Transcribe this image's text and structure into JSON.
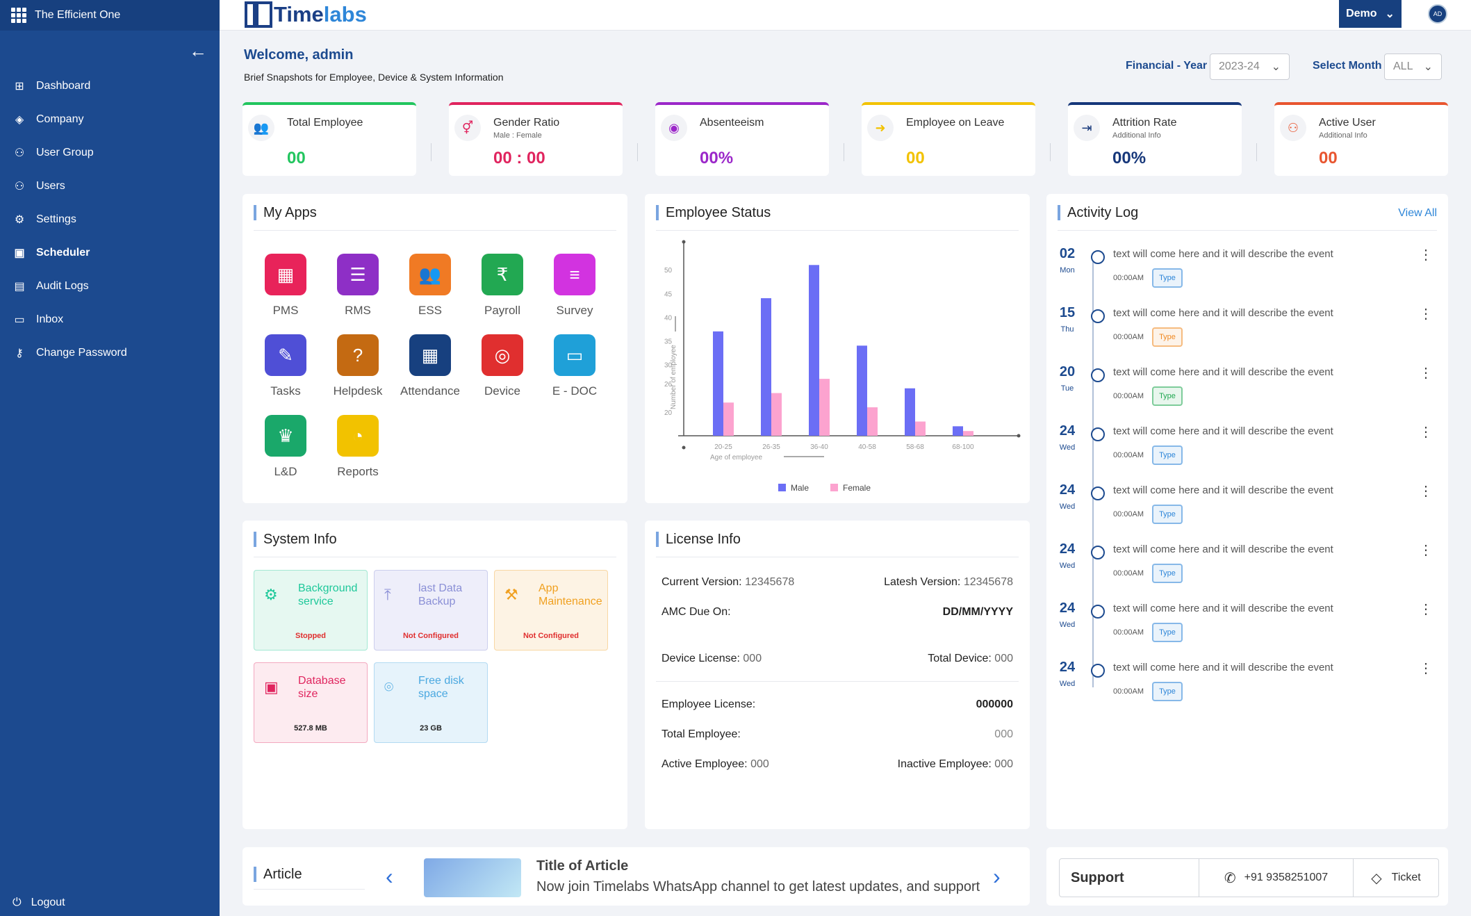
{
  "app": {
    "org_name": "The Efficient One",
    "logo_prefix": "Time",
    "logo_suffix": "labs",
    "user_menu": "Demo",
    "avatar_initials": "AD"
  },
  "sidebar": {
    "items": [
      {
        "label": "Dashboard",
        "icon": "dashboard-icon"
      },
      {
        "label": "Company",
        "icon": "layers-icon"
      },
      {
        "label": "User Group",
        "icon": "user-group-icon"
      },
      {
        "label": "Users",
        "icon": "users-icon"
      },
      {
        "label": "Settings",
        "icon": "gear-icon"
      },
      {
        "label": "Scheduler",
        "icon": "scheduler-icon"
      },
      {
        "label": "Audit Logs",
        "icon": "document-icon"
      },
      {
        "label": "Inbox",
        "icon": "inbox-icon"
      },
      {
        "label": "Change Password",
        "icon": "key-icon"
      }
    ],
    "logout": "Logout"
  },
  "header": {
    "welcome": "Welcome, admin",
    "brief": "Brief Snapshots for Employee, Device & System Information",
    "fy_label": "Financial - Year",
    "fy_value": "2023-24",
    "month_label": "Select Month",
    "month_value": "ALL"
  },
  "stats": [
    {
      "title": "Total Employee",
      "sub": "",
      "value": "00",
      "color": "#22c55e"
    },
    {
      "title": "Gender Ratio",
      "sub": "Male : Female",
      "value": "00 : 00",
      "color": "#e0245e"
    },
    {
      "title": "Absenteeism",
      "sub": "",
      "value": "00%",
      "color": "#9b27c9"
    },
    {
      "title": "Employee on Leave",
      "sub": "",
      "value": "00",
      "color": "#f2c200"
    },
    {
      "title": "Attrition Rate",
      "sub": "Additional Info",
      "value": "00%",
      "color": "#16377a"
    },
    {
      "title": "Active User",
      "sub": "Additional Info",
      "value": "00",
      "color": "#e8552f"
    }
  ],
  "apps": {
    "title": "My Apps",
    "items": [
      {
        "label": "PMS",
        "color": "#e8235a",
        "icon": "bar-chart-icon",
        "glyph": "▦"
      },
      {
        "label": "RMS",
        "color": "#8e2fc6",
        "icon": "list-icon",
        "glyph": "☰"
      },
      {
        "label": "ESS",
        "color": "#f07a24",
        "icon": "people-icon",
        "glyph": "👥"
      },
      {
        "label": "Payroll",
        "color": "#22a852",
        "icon": "money-icon",
        "glyph": "₹"
      },
      {
        "label": "Survey",
        "color": "#d233e0",
        "icon": "survey-icon",
        "glyph": "≡"
      },
      {
        "label": "Tasks",
        "color": "#4f4fd6",
        "icon": "tasks-icon",
        "glyph": "✎"
      },
      {
        "label": "Helpdesk",
        "color": "#c46a12",
        "icon": "help-icon",
        "glyph": "?"
      },
      {
        "label": "Attendance",
        "color": "#17407f",
        "icon": "calendar-icon",
        "glyph": "▦"
      },
      {
        "label": "Device",
        "color": "#e02f2f",
        "icon": "fingerprint-icon",
        "glyph": "◎"
      },
      {
        "label": "E - DOC",
        "color": "#1fa0d8",
        "icon": "folder-icon",
        "glyph": "▭"
      },
      {
        "label": "L&D",
        "color": "#1aa86a",
        "icon": "learning-icon",
        "glyph": "♛"
      },
      {
        "label": "Reports",
        "color": "#f2c200",
        "icon": "pie-icon",
        "glyph": "◔"
      }
    ]
  },
  "employee_status": {
    "title": "Employee Status"
  },
  "chart_data": {
    "type": "bar",
    "categories": [
      "20-25",
      "26-35",
      "36-40",
      "40-58",
      "58-68",
      "68-100"
    ],
    "series": [
      {
        "name": "Male",
        "values": [
          37,
          44,
          51,
          34,
          25,
          17
        ]
      },
      {
        "name": "Female",
        "values": [
          22,
          24,
          27,
          21,
          18,
          16
        ]
      }
    ],
    "xlabel": "Age of employee",
    "ylabel": "Number of employee",
    "yticks": [
      "20",
      "26",
      "30",
      "35",
      "40",
      "45",
      "50"
    ],
    "ylim": [
      15,
      55
    ],
    "colors": {
      "Male": "#6b6ef5",
      "Female": "#fca3cf"
    },
    "legend": "bottom"
  },
  "activity": {
    "title": "Activity Log",
    "view_all": "View All",
    "items": [
      {
        "day": "02",
        "dow": "Mon",
        "text": "text will come here and it will describe the event",
        "time": "00:00AM",
        "type": "Type",
        "type_color": "#2e86d8"
      },
      {
        "day": "15",
        "dow": "Thu",
        "text": "text will come here and it will describe the event",
        "time": "00:00AM",
        "type": "Type",
        "type_color": "#f08a24"
      },
      {
        "day": "20",
        "dow": "Tue",
        "text": "text will come here and it will describe the event",
        "time": "00:00AM",
        "type": "Type",
        "type_color": "#22a852"
      },
      {
        "day": "24",
        "dow": "Wed",
        "text": "text will come here and it will describe the event",
        "time": "00:00AM",
        "type": "Type",
        "type_color": "#2e86d8"
      },
      {
        "day": "24",
        "dow": "Wed",
        "text": "text will come here and it will describe the event",
        "time": "00:00AM",
        "type": "Type",
        "type_color": "#2e86d8"
      },
      {
        "day": "24",
        "dow": "Wed",
        "text": "text will come here and it will describe the event",
        "time": "00:00AM",
        "type": "Type",
        "type_color": "#2e86d8"
      },
      {
        "day": "24",
        "dow": "Wed",
        "text": "text will come here and it will describe the event",
        "time": "00:00AM",
        "type": "Type",
        "type_color": "#2e86d8"
      },
      {
        "day": "24",
        "dow": "Wed",
        "text": "text will come here and it will describe the event",
        "time": "00:00AM",
        "type": "Type",
        "type_color": "#2e86d8"
      }
    ]
  },
  "system_info": {
    "title": "System Info",
    "items": [
      {
        "label": "Background service",
        "status": "Stopped",
        "color": "#1ec89a",
        "bg": "#e6f8f1",
        "status_color": "#e02f2f",
        "icon": "gear-icon",
        "glyph": "⚙"
      },
      {
        "label": "last Data Backup",
        "status": "Not Configured",
        "color": "#8a8fd6",
        "bg": "#eeeefa",
        "status_color": "#e02f2f",
        "icon": "upload-icon",
        "glyph": "⤒"
      },
      {
        "label": "App Maintenance",
        "status": "Not Configured",
        "color": "#f0a020",
        "bg": "#fdf3e4",
        "status_color": "#e02f2f",
        "icon": "tools-icon",
        "glyph": "⚒"
      },
      {
        "label": "Database size",
        "status": "527.8 MB",
        "color": "#e0245e",
        "bg": "#fdebf0",
        "status_color": "#222",
        "icon": "database-icon",
        "glyph": "▣"
      },
      {
        "label": "Free disk space",
        "status": "23 GB",
        "color": "#4aa8e0",
        "bg": "#e6f3fb",
        "status_color": "#222",
        "icon": "disk-icon",
        "glyph": "⌾"
      }
    ]
  },
  "license": {
    "title": "License Info",
    "current_version_label": "Current Version:",
    "current_version": "12345678",
    "latest_version_label": "Latesh Version:",
    "latest_version": "12345678",
    "amc_label": "AMC Due On:",
    "amc_value": "DD/MM/YYYY",
    "device_license_label": "Device License:",
    "device_license": "000",
    "total_device_label": "Total Device:",
    "total_device": "000",
    "employee_license_label": "Employee License:",
    "employee_license": "000000",
    "total_employee_label": "Total Employee:",
    "total_employee": "000",
    "active_employee_label": "Active Employee:",
    "active_employee": "000",
    "inactive_employee_label": "Inactive Employee:",
    "inactive_employee": "000"
  },
  "article": {
    "label": "Article",
    "title": "Title of Article",
    "text": "Now join Timelabs WhatsApp channel to get latest updates, and support"
  },
  "support": {
    "label": "Support",
    "phone": "+91 9358251007",
    "ticket": "Ticket"
  }
}
